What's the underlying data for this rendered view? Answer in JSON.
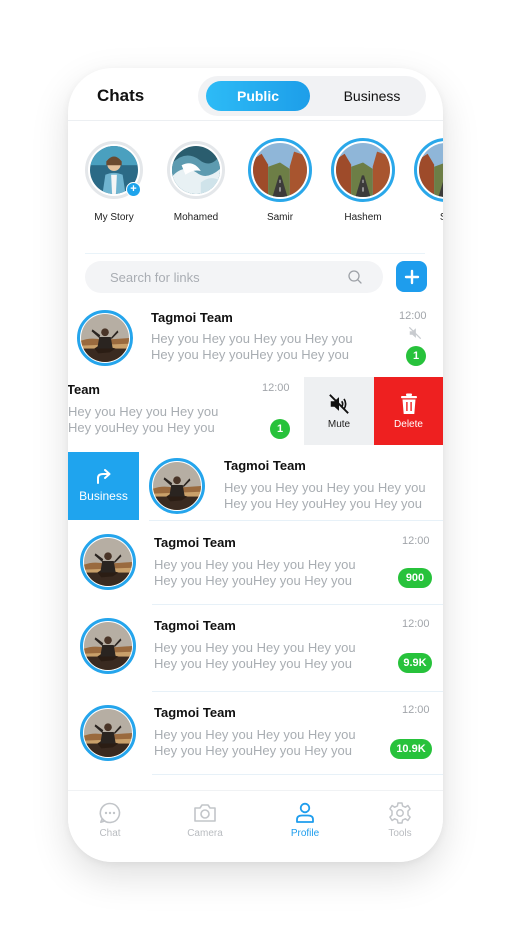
{
  "header": {
    "title": "Chats",
    "segments": [
      "Public",
      "Business"
    ],
    "active_segment": "Public"
  },
  "stories": [
    {
      "name": "My Story",
      "has_add": true
    },
    {
      "name": "Mohamed"
    },
    {
      "name": "Samir"
    },
    {
      "name": "Hashem"
    },
    {
      "name": "Sa"
    }
  ],
  "search": {
    "placeholder": "Search for links"
  },
  "chats": [
    {
      "name": "Tagmoi Team",
      "line1": "Hey you Hey you Hey you Hey you",
      "line2": "Hey you Hey youHey you Hey you",
      "time": "12:00",
      "muted": true,
      "badge": "1"
    },
    {
      "name": "Team",
      "line1": "Hey you Hey you Hey you",
      "line2": "Hey youHey you Hey you",
      "time": "12:00",
      "badge": "1"
    },
    {
      "name": "Tagmoi Team",
      "line1": "Hey you Hey you Hey you Hey you",
      "line2": "Hey you Hey youHey you Hey you"
    },
    {
      "name": "Tagmoi Team",
      "line1": "Hey you Hey you Hey you Hey you",
      "line2": "Hey you Hey youHey you Hey you",
      "time": "12:00",
      "badge": "900"
    },
    {
      "name": "Tagmoi Team",
      "line1": "Hey you Hey you Hey you Hey you",
      "line2": "Hey you Hey youHey you Hey you",
      "time": "12:00",
      "badge": "9.9K"
    },
    {
      "name": "Tagmoi Team",
      "line1": "Hey you Hey you Hey you Hey you",
      "line2": "Hey you Hey youHey you Hey you",
      "time": "12:00",
      "badge": "10.9K"
    }
  ],
  "swipe_actions": {
    "mute": "Mute",
    "delete": "Delete",
    "business": "Business"
  },
  "tabbar": [
    {
      "label": "Chat",
      "icon": "chat-bubble-icon"
    },
    {
      "label": "Camera",
      "icon": "camera-icon"
    },
    {
      "label": "Profile",
      "icon": "profile-icon",
      "active": true
    },
    {
      "label": "Tools",
      "icon": "gear-icon"
    }
  ],
  "colors": {
    "accent": "#1e9ded",
    "badge": "#27c23b",
    "delete": "#ee2020"
  }
}
